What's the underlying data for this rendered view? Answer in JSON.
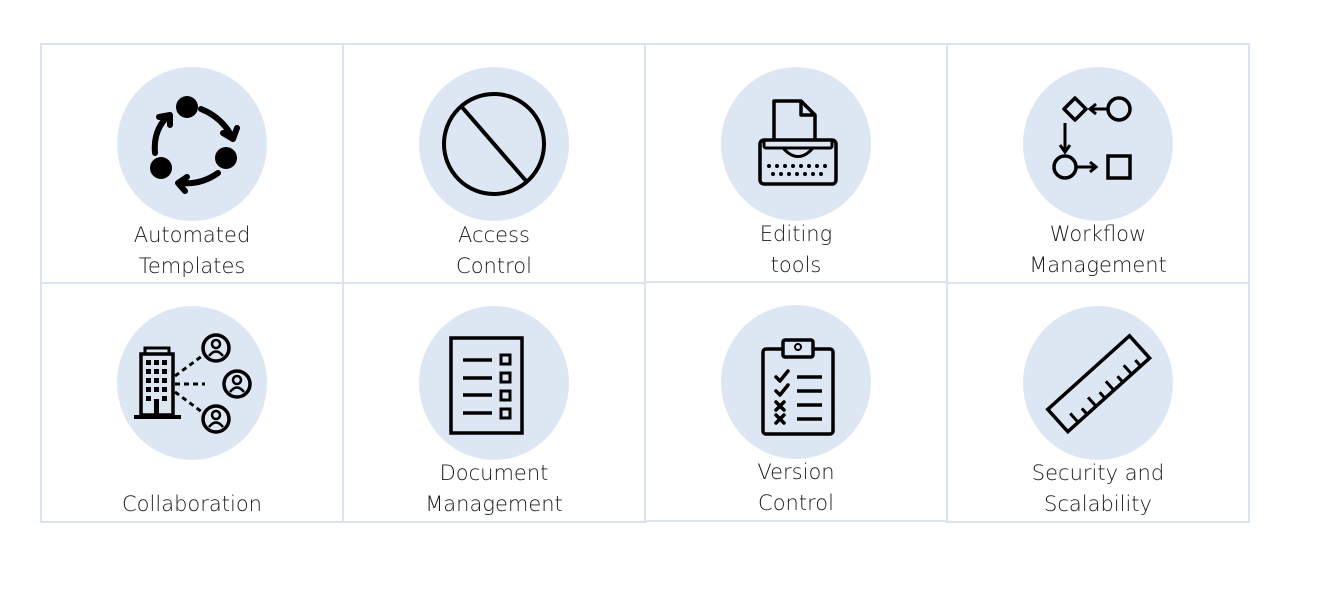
{
  "features": [
    {
      "id": "automated-templates",
      "icon": "cycle-arrows-icon",
      "lines": [
        "Automated",
        "Templates"
      ]
    },
    {
      "id": "access-control",
      "icon": "prohibited-icon",
      "lines": [
        "Access",
        "Control"
      ]
    },
    {
      "id": "editing-tools",
      "icon": "typewriter-icon",
      "lines": [
        "Editing",
        "tools"
      ]
    },
    {
      "id": "workflow-management",
      "icon": "flowchart-icon",
      "lines": [
        "Workflow",
        "Management"
      ]
    },
    {
      "id": "collaboration",
      "icon": "building-network-icon",
      "lines": [
        "",
        "Collaboration"
      ]
    },
    {
      "id": "document-management",
      "icon": "document-checklist-icon",
      "lines": [
        "Document",
        "Management"
      ]
    },
    {
      "id": "version-control",
      "icon": "clipboard-checklist-icon",
      "lines": [
        "Version",
        "Control"
      ]
    },
    {
      "id": "security-and-scalability",
      "icon": "ruler-icon",
      "lines": [
        "Security and",
        "Scalability"
      ]
    }
  ],
  "colors": {
    "circle": "#dde7f4",
    "border": "#dae3f0",
    "icon": "#000000"
  }
}
